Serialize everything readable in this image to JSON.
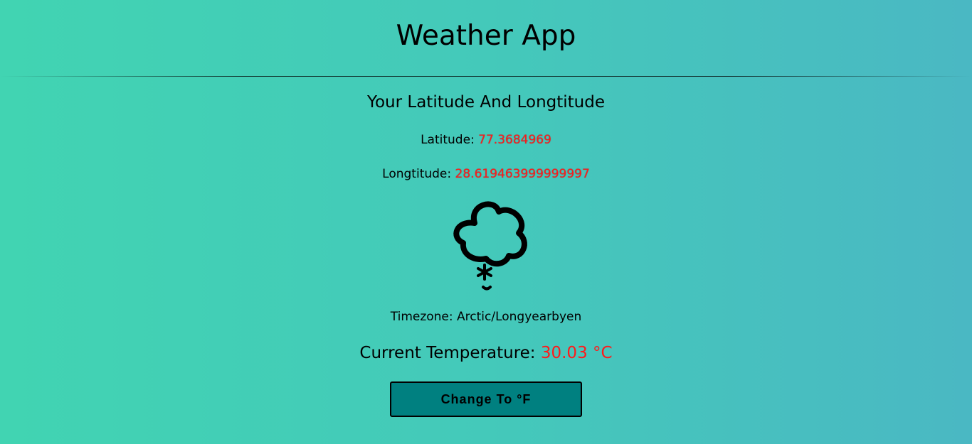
{
  "app": {
    "title": "Weather App"
  },
  "location": {
    "heading": "Your Latitude And Longtitude",
    "latitude_label": "Latitude:",
    "latitude_value": "77.3684969",
    "longitude_label": "Longtitude:",
    "longitude_value": "28.619463999999997"
  },
  "weather": {
    "icon": "snow-cloud-icon",
    "timezone_label": "Timezone:",
    "timezone_value": "Arctic/Longyearbyen",
    "temperature_label": "Current Temperature:",
    "temperature_value": "30.03 °C"
  },
  "controls": {
    "change_unit_label": "Change To °F"
  },
  "colors": {
    "gradient_start": "#41d4b2",
    "gradient_end": "#4ab8c3",
    "value_red": "#ff1a1a",
    "button_bg": "#008080"
  }
}
